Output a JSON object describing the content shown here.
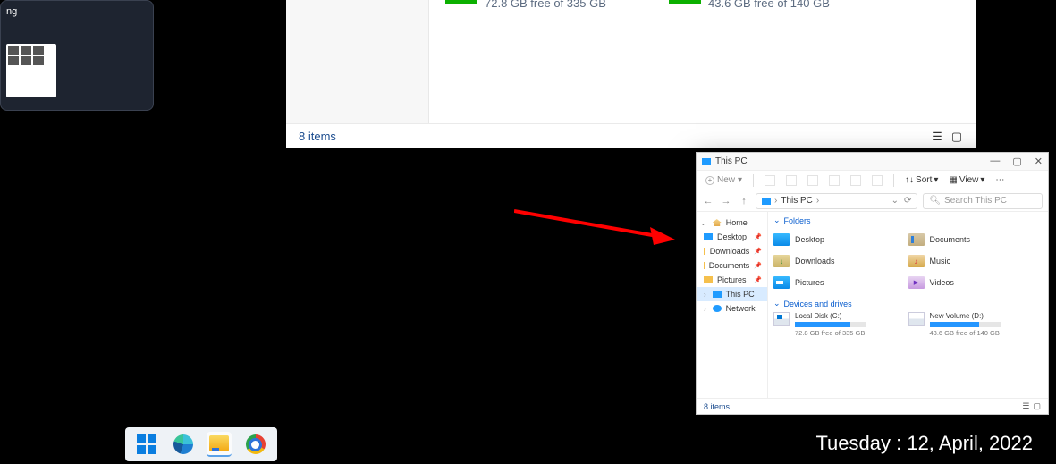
{
  "taskview": {
    "title_suffix": "ng"
  },
  "big_explorer": {
    "drives": [
      {
        "free_text": "72.8 GB free of 335 GB",
        "fill_pct": 78
      },
      {
        "free_text": "43.6 GB free of 140 GB",
        "fill_pct": 69
      }
    ],
    "item_count": "8 items"
  },
  "explorer": {
    "title": "This PC",
    "toolbar": {
      "new": "New",
      "sort": "Sort",
      "view": "View"
    },
    "address": {
      "location": "This PC",
      "search_placeholder": "Search This PC"
    },
    "sidebar": {
      "home": "Home",
      "quick": [
        "Desktop",
        "Downloads",
        "Documents",
        "Pictures"
      ],
      "this_pc": "This PC",
      "network": "Network"
    },
    "groups": {
      "folders": {
        "label": "Folders",
        "items": [
          "Desktop",
          "Documents",
          "Downloads",
          "Music",
          "Pictures",
          "Videos"
        ]
      },
      "drives": {
        "label": "Devices and drives",
        "items": [
          {
            "name": "Local Disk (C:)",
            "free": "72.8 GB free of 335 GB",
            "fill_pct": 78
          },
          {
            "name": "New Volume (D:)",
            "free": "43.6 GB free of 140 GB",
            "fill_pct": 69
          }
        ]
      }
    },
    "status": "8 items"
  },
  "date_overlay": "Tuesday : 12, April, 2022"
}
